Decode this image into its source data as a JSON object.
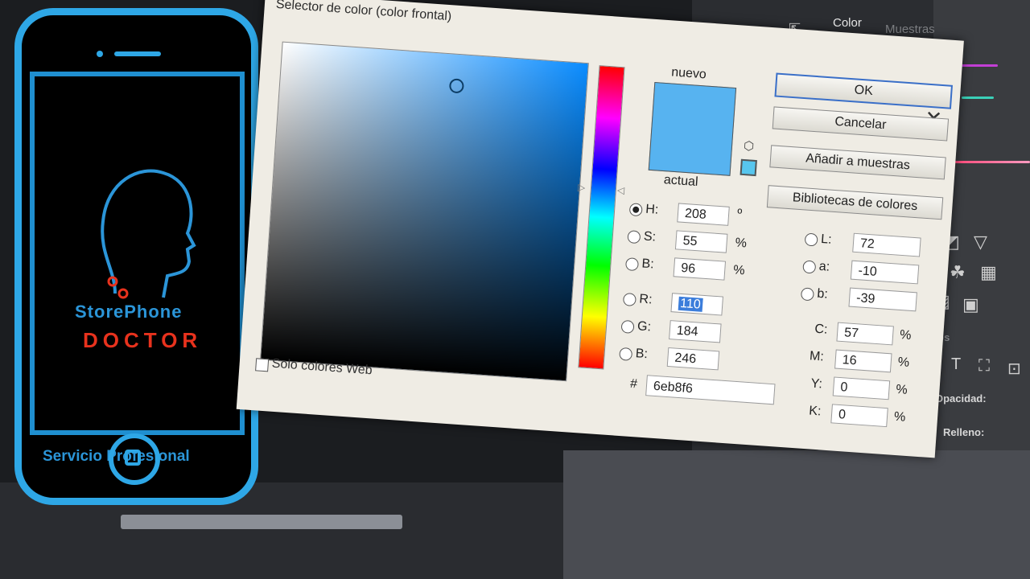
{
  "dialog": {
    "title": "Selector de color (color frontal)",
    "close_symbol": "✕",
    "new_label": "nuevo",
    "current_label": "actual",
    "new_color": "#57b3f0",
    "buttons": {
      "ok": "OK",
      "cancel": "Cancelar",
      "add_swatches": "Añadir a muestras",
      "color_libraries": "Bibliotecas de colores"
    },
    "web_only_label": "Solo colores Web",
    "hsb": [
      {
        "label": "H:",
        "value": "208",
        "unit": "º",
        "selected": true
      },
      {
        "label": "S:",
        "value": "55",
        "unit": "%",
        "selected": false
      },
      {
        "label": "B:",
        "value": "96",
        "unit": "%",
        "selected": false
      }
    ],
    "rgb": [
      {
        "label": "R:",
        "value": "110"
      },
      {
        "label": "G:",
        "value": "184"
      },
      {
        "label": "B:",
        "value": "246"
      }
    ],
    "lab": [
      {
        "label": "L:",
        "value": "72"
      },
      {
        "label": "a:",
        "value": "-10"
      },
      {
        "label": "b:",
        "value": "-39"
      }
    ],
    "cmyk": [
      {
        "label": "C:",
        "value": "57",
        "unit": "%"
      },
      {
        "label": "M:",
        "value": "16",
        "unit": "%"
      },
      {
        "label": "Y:",
        "value": "0",
        "unit": "%"
      },
      {
        "label": "K:",
        "value": "0",
        "unit": "%"
      }
    ],
    "hex_prefix": "#",
    "hex": "6eb8f6"
  },
  "artwork": {
    "brand_line1": "StorePhone",
    "brand_line2": "DOCTOR",
    "service": "Servicio Profesional"
  },
  "photoshop": {
    "tab_color": "Color",
    "tab_swatches": "Muestras",
    "opacity_label": "Opacidad:",
    "fill_label": "Relleno:",
    "layers_fragment": "ados"
  }
}
